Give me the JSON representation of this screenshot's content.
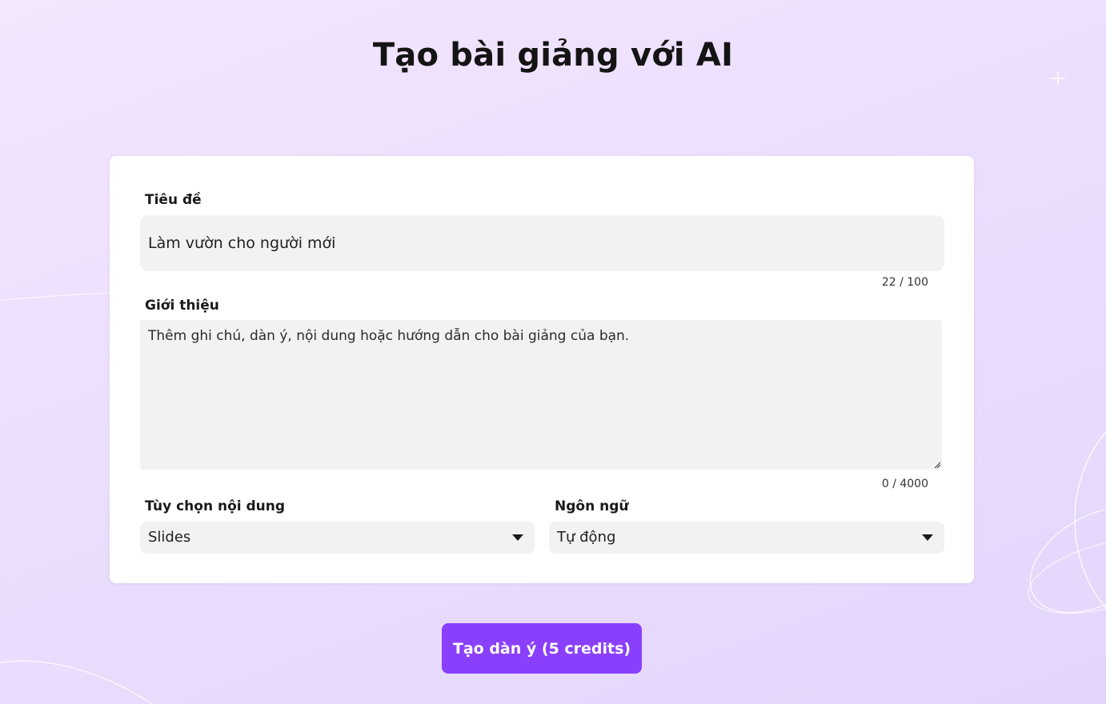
{
  "page": {
    "title": "Tạo bài giảng với AI"
  },
  "form": {
    "title_field": {
      "label": "Tiêu đề",
      "value": "Làm vườn cho người mới",
      "counter": "22 / 100"
    },
    "intro_field": {
      "label": "Giới thiệu",
      "placeholder": "Thêm ghi chú, dàn ý, nội dung hoặc hướng dẫn cho bài giảng của bạn.",
      "value": "",
      "counter": "0 / 4000"
    },
    "content_option": {
      "label": "Tùy chọn nội dung",
      "selected": "Slides"
    },
    "language": {
      "label": "Ngôn ngữ",
      "selected": "Tự động"
    }
  },
  "actions": {
    "generate_label": "Tạo dàn ý (5 credits)"
  },
  "colors": {
    "accent": "#8a3ffc",
    "background": "#ecdffd",
    "field_bg": "#f2f2f2"
  },
  "icons": {
    "dropdown": "caret-down-icon",
    "sparkle": "sparkle-icon"
  }
}
